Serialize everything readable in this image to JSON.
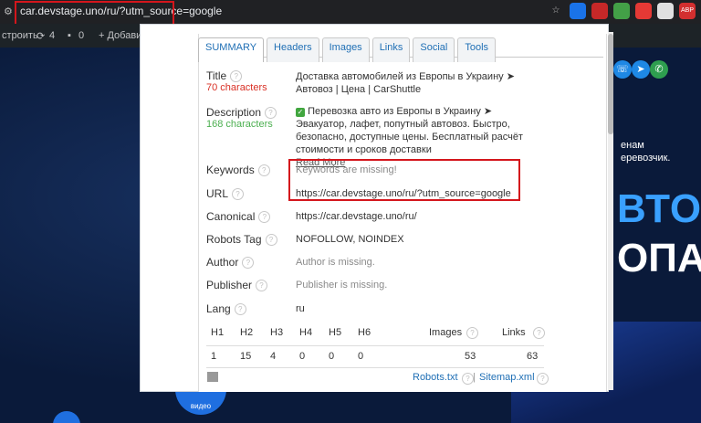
{
  "browser": {
    "url": "car.devstage.uno/ru/?utm_source=google",
    "ext_badge": "ABP"
  },
  "wp_bar": {
    "customize": "строить",
    "updates": "4",
    "comments": "0",
    "add": "+ Добавит"
  },
  "page": {
    "right_text": [
      "енам",
      "еревозчик."
    ],
    "big1": "ВТО",
    "big2": "ОПА",
    "badge": "видео"
  },
  "tabs": [
    "SUMMARY",
    "Headers",
    "Images",
    "Links",
    "Social",
    "Tools"
  ],
  "summary": {
    "title_label": "Title",
    "title_count": "70 characters",
    "title_value": "Доставка автомобилей из Европы в Украину ➤ Автовоз | Цена | CarShuttle",
    "description_label": "Description",
    "description_count": "168 characters",
    "description_value": "Перевозка авто из Европы в Украину ➤ Эвакуатор, лафет, попутный автовоз. Быстро, безопасно, доступные цены. Бесплатный расчёт стоимости и сроков доставки",
    "read_more": "Read More",
    "keywords_label": "Keywords",
    "keywords_value": "Keywords are missing!",
    "url_label": "URL",
    "url_value": "https://car.devstage.uno/ru/?utm_source=google",
    "canonical_label": "Canonical",
    "canonical_value": "https://car.devstage.uno/ru/",
    "robots_label": "Robots Tag",
    "robots_value": "NOFOLLOW, NOINDEX",
    "author_label": "Author",
    "author_value": "Author is missing.",
    "publisher_label": "Publisher",
    "publisher_value": "Publisher is missing.",
    "lang_label": "Lang",
    "lang_value": "ru"
  },
  "headings_table": {
    "headers": [
      "H1",
      "H2",
      "H3",
      "H4",
      "H5",
      "H6",
      "Images",
      "Links"
    ],
    "values": [
      "1",
      "15",
      "4",
      "0",
      "0",
      "0",
      "53",
      "63"
    ]
  },
  "footer": {
    "robots_link": "Robots.txt",
    "sitemap_link": "Sitemap.xml",
    "separator": "|"
  },
  "colors": {
    "accent": "#1f6fb5",
    "highlight_box": "#d4161c",
    "title_count_color": "#d93025",
    "desc_count_color": "#4caf50"
  }
}
